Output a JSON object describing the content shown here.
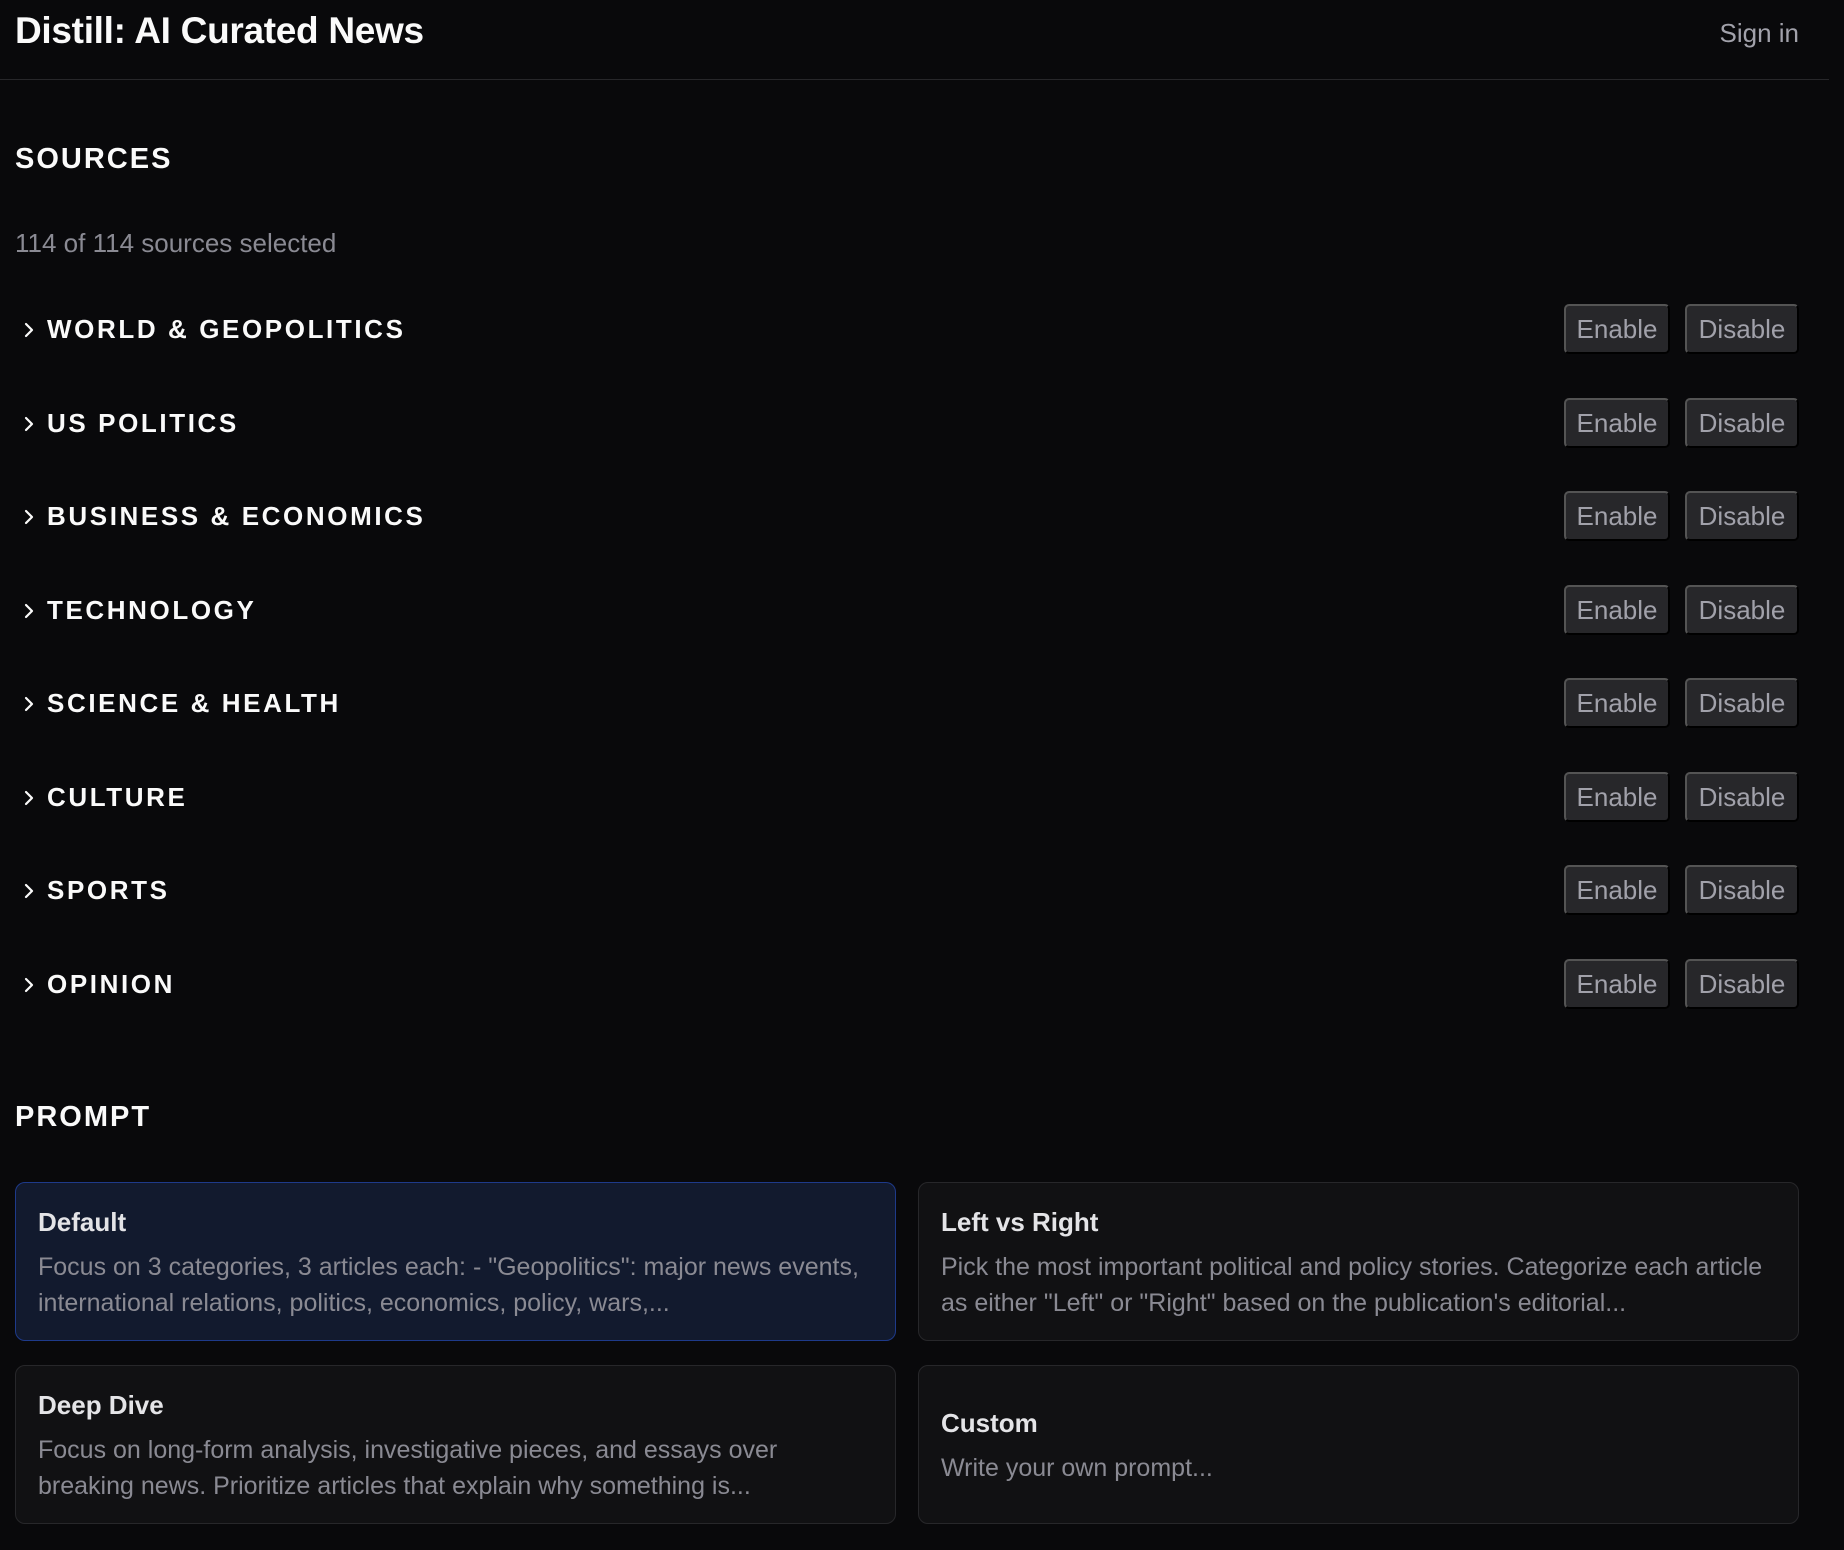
{
  "header": {
    "title": "Distill: AI Curated News",
    "sign_in": "Sign in"
  },
  "sources": {
    "heading": "SOURCES",
    "count_text": "114 of 114 sources selected",
    "enable_label": "Enable",
    "disable_label": "Disable",
    "categories": [
      {
        "label": "WORLD & GEOPOLITICS"
      },
      {
        "label": "US POLITICS"
      },
      {
        "label": "BUSINESS & ECONOMICS"
      },
      {
        "label": "TECHNOLOGY"
      },
      {
        "label": "SCIENCE & HEALTH"
      },
      {
        "label": "CULTURE"
      },
      {
        "label": "SPORTS"
      },
      {
        "label": "OPINION"
      }
    ]
  },
  "prompt": {
    "heading": "PROMPT",
    "cards": [
      {
        "title": "Default",
        "description": "Focus on 3 categories, 3 articles each: - \"Geopolitics\": major news events, international relations, politics, economics, policy, wars,...",
        "selected": true
      },
      {
        "title": "Left vs Right",
        "description": "Pick the most important political and policy stories. Categorize each article as either \"Left\" or \"Right\" based on the publication's editorial...",
        "selected": false
      },
      {
        "title": "Deep Dive",
        "description": "Focus on long-form analysis, investigative pieces, and essays over breaking news. Prioritize articles that explain why something is...",
        "selected": false
      },
      {
        "title": "Custom",
        "description": "Write your own prompt...",
        "selected": false
      }
    ]
  },
  "theme": {
    "background": "#09090b",
    "surface": "#111113",
    "button": "#27272a",
    "selected_surface": "#121a2e",
    "selected_border": "#1e3a8a",
    "text": "#fafafa",
    "muted_text": "#8a8a93"
  },
  "icons": {
    "category_toggle": "chevron-right-icon"
  }
}
